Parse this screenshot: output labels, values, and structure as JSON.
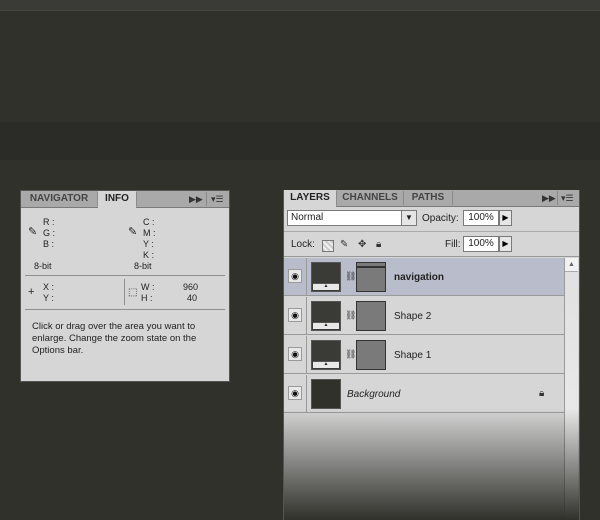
{
  "info_panel": {
    "tabs": [
      "NAVIGATOR",
      "INFO"
    ],
    "ctrl_expand": "▶▶",
    "ctrl_menu": "▾☰",
    "rgb_labels": [
      "R :",
      "G :",
      "B :"
    ],
    "rgb_bitdepth": "8-bit",
    "cmyk_labels": [
      "C :",
      "M :",
      "Y :",
      "K :"
    ],
    "cmyk_bitdepth": "8-bit",
    "xy_labels": [
      "X :",
      "Y :"
    ],
    "w_label": "W :",
    "h_label": "H :",
    "w_value": "960",
    "h_value": "40",
    "help_text": "Click or drag over the area you want to enlarge. Change the zoom state on the Options bar."
  },
  "layers_panel": {
    "tabs": [
      "LAYERS",
      "CHANNELS",
      "PATHS"
    ],
    "ctrl_expand": "▶▶",
    "ctrl_menu": "▾☰",
    "blend_mode": "Normal",
    "opacity_label": "Opacity:",
    "opacity_value": "100%",
    "lock_label": "Lock:",
    "fill_label": "Fill:",
    "fill_value": "100%",
    "layers": [
      {
        "name": "navigation",
        "selected": true,
        "has_mask": true
      },
      {
        "name": "Shape 2",
        "selected": false,
        "has_mask": true
      },
      {
        "name": "Shape 1",
        "selected": false,
        "has_mask": true
      },
      {
        "name": "Background",
        "selected": false,
        "has_mask": false,
        "locked": true
      }
    ]
  },
  "colors": {
    "canvas": "#30312b",
    "panel_bg": "#d6d6d6",
    "selected_row": "#b9bccb"
  }
}
